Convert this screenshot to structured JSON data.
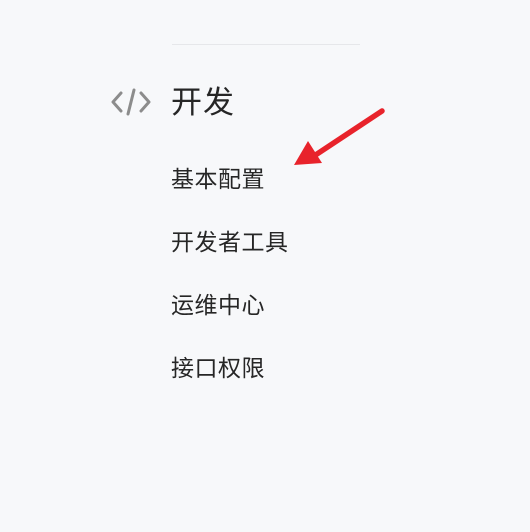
{
  "section": {
    "icon": "code-icon",
    "title": "开发"
  },
  "menu": {
    "items": [
      {
        "label": "基本配置"
      },
      {
        "label": "开发者工具"
      },
      {
        "label": "运维中心"
      },
      {
        "label": "接口权限"
      }
    ]
  },
  "annotation": {
    "type": "arrow",
    "color": "#e8232b"
  },
  "colors": {
    "background": "#f7f8fa",
    "text": "#262626",
    "icon": "#8c8c8c",
    "divider": "#e6e7ea"
  }
}
